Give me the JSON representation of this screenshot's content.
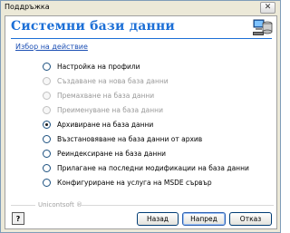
{
  "window": {
    "title": "Поддръжка",
    "close_glyph": "✕"
  },
  "header": {
    "title": "Системни бази данни",
    "icon": "database-computer-icon"
  },
  "section": {
    "label": "Избор на действие"
  },
  "options": [
    {
      "label": "Настройка на профили",
      "enabled": true,
      "checked": false
    },
    {
      "label": "Създаване на нова база данни",
      "enabled": false,
      "checked": false
    },
    {
      "label": "Премахване на база данни",
      "enabled": false,
      "checked": false
    },
    {
      "label": "Преименуване на база данни",
      "enabled": false,
      "checked": false
    },
    {
      "label": "Архивиране на база данни",
      "enabled": true,
      "checked": true
    },
    {
      "label": "Възстановяване на база данни от архив",
      "enabled": true,
      "checked": false
    },
    {
      "label": "Реиндексиране на база данни",
      "enabled": true,
      "checked": false
    },
    {
      "label": "Прилагане на последни модификации на база данни",
      "enabled": true,
      "checked": false
    },
    {
      "label": "Конфигуриране на услуга на MSDE сървър",
      "enabled": true,
      "checked": false
    }
  ],
  "footer": {
    "brand": "Unicontsoft ®",
    "help_glyph": "?",
    "back_label": "Назад",
    "next_label": "Напред",
    "cancel_label": "Отказ"
  },
  "colors": {
    "title_blue": "#1c6fd6",
    "dialog_bg": "#ece9d8"
  }
}
